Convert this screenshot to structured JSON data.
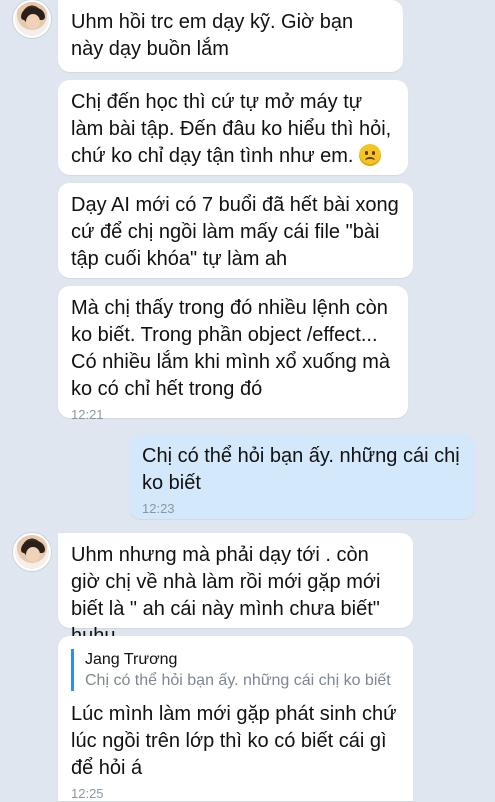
{
  "chat": {
    "messages": [
      {
        "direction": "in",
        "text": "Uhm hồi trc em dạy kỹ. Giờ bạn này dạy buồn lắm"
      },
      {
        "direction": "in",
        "text": "Chị đến học thì cứ tự mở máy tự làm bài tập. Đến đâu ko hiểu thì hỏi, chứ ko chỉ dạy tận tình như em.",
        "emoji": "frowning-face-emoji"
      },
      {
        "direction": "in",
        "text": "Dạy AI mới có 7 buổi đã hết bài xong cứ để chị ngồi làm mấy cái file \"bài tập cuối khóa\" tự làm ah"
      },
      {
        "direction": "in",
        "text": "Mà chị thấy trong đó nhiều lệnh còn ko biết. Trong phần object /effect... Có nhiều lắm khi mình xổ xuống mà ko có chỉ hết trong đó",
        "time": "12:21"
      },
      {
        "direction": "out",
        "text": "Chị có thể hỏi bạn ấy. những cái chị ko biết",
        "time": "12:23"
      },
      {
        "direction": "in",
        "text": "Uhm nhưng mà phải dạy tới . còn giờ chị về nhà làm rồi mới gặp mới biết là \" ah cái này mình chưa biết\" huhu"
      },
      {
        "direction": "in",
        "reply": {
          "name": "Jang Trương",
          "text": "Chị có thể hỏi bạn ấy. những cái chị ko biết"
        },
        "text": "Lúc mình làm mới gặp phát sinh chứ lúc ngồi trên lớp thì ko có biết cái gì để hỏi á",
        "time": "12:25"
      }
    ]
  },
  "colors": {
    "background": "#dfe6ef",
    "incoming_bubble": "#ffffff",
    "outgoing_bubble": "#d4e8fb",
    "reply_accent": "#2f8ef0"
  }
}
